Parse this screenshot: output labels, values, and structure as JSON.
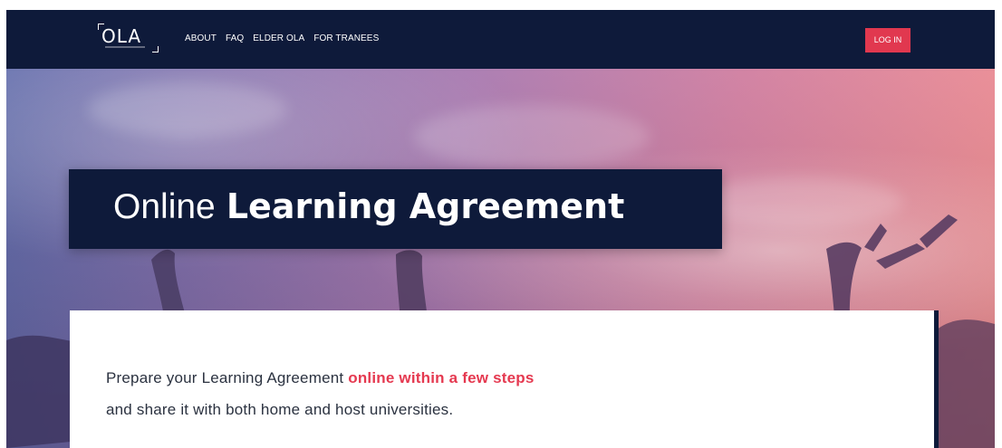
{
  "colors": {
    "navbar": "#0e1a3a",
    "accent": "#e1384f",
    "highlight": "#e53950",
    "text": "#2b3240"
  },
  "nav": {
    "logo": "OLA",
    "links": [
      {
        "label": "ABOUT"
      },
      {
        "label": "FAQ"
      },
      {
        "label": "ELDER OLA"
      },
      {
        "label": "FOR TRANEES"
      }
    ],
    "login_label": "LOG IN"
  },
  "hero": {
    "title_light": "Online",
    "title_bold": "Learning Agreement"
  },
  "intro": {
    "line1_prefix": "Prepare your Learning Agreement ",
    "line1_highlight": "online within a few steps",
    "line2": "and share it with both home and host universities."
  }
}
